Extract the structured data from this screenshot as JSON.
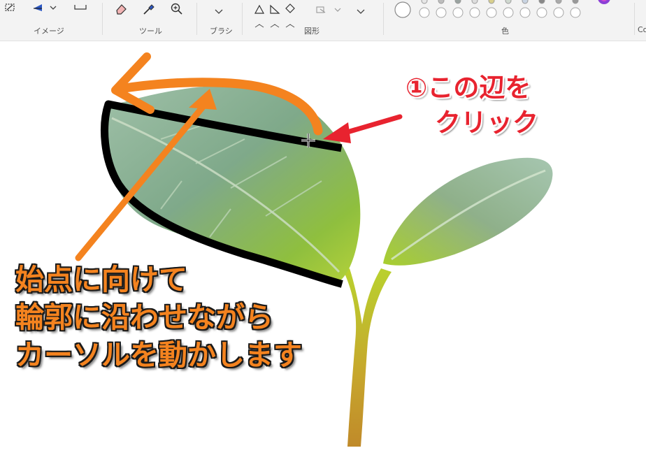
{
  "ribbon": {
    "groups": {
      "image": "イメージ",
      "tools": "ツール",
      "brushes": "ブラシ",
      "shapes": "図形",
      "colors": "色",
      "copilot_partial": "Co"
    }
  },
  "annotations": {
    "step1_line1": "①この辺を",
    "step1_line2": "クリック",
    "step2_line1": "始点に向けて",
    "step2_line2": "輪郭に沿わせながら",
    "step2_line3": "カーソルを動かします"
  },
  "colors": {
    "ribbon_bg": "#f3f3f3",
    "annotation_red": "#e8232f",
    "annotation_orange": "#f4831f",
    "outline_black": "#000000",
    "leaf_green": "#7cb342"
  }
}
